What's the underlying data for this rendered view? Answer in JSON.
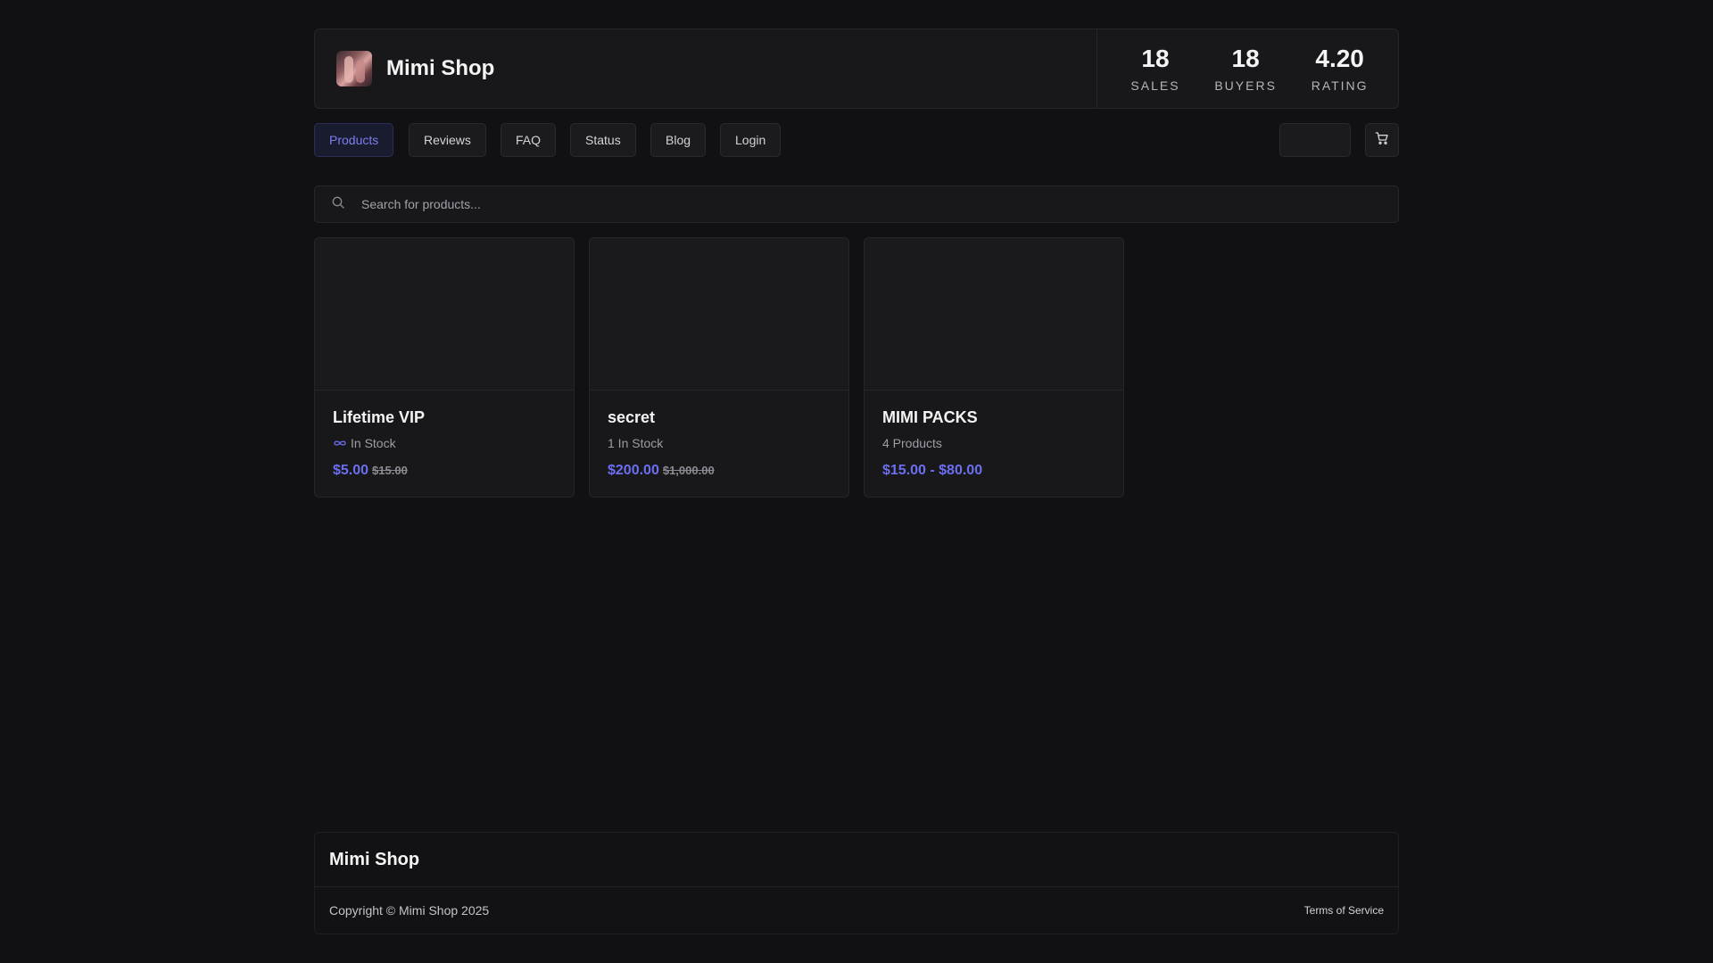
{
  "shop": {
    "name": "Mimi Shop"
  },
  "stats": [
    {
      "value": "18",
      "label": "SALES"
    },
    {
      "value": "18",
      "label": "BUYERS"
    },
    {
      "value": "4.20",
      "label": "RATING"
    }
  ],
  "nav": {
    "items": [
      {
        "label": "Products",
        "active": true
      },
      {
        "label": "Reviews"
      },
      {
        "label": "FAQ"
      },
      {
        "label": "Status"
      },
      {
        "label": "Blog"
      },
      {
        "label": "Login"
      }
    ],
    "cart_icon": "cart-icon"
  },
  "search": {
    "placeholder": "Search for products...",
    "value": "",
    "icon": "search-icon"
  },
  "products": [
    {
      "title": "Lifetime VIP",
      "stock": "In Stock",
      "stock_icon": "infinity-icon",
      "price": "$5.00",
      "old_price": "$15.00"
    },
    {
      "title": "secret",
      "stock": "1 In Stock",
      "price": "$200.00",
      "old_price": "$1,000.00"
    },
    {
      "title": "MIMI PACKS",
      "stock": "4 Products",
      "price": "$15.00 - $80.00"
    }
  ],
  "footer": {
    "title": "Mimi Shop",
    "copyright": "Copyright © Mimi Shop 2025",
    "terms": "Terms of Service"
  },
  "colors": {
    "background": "#111113",
    "card": "#18181b",
    "accent": "#6b6ff0",
    "border": "#26262a"
  }
}
